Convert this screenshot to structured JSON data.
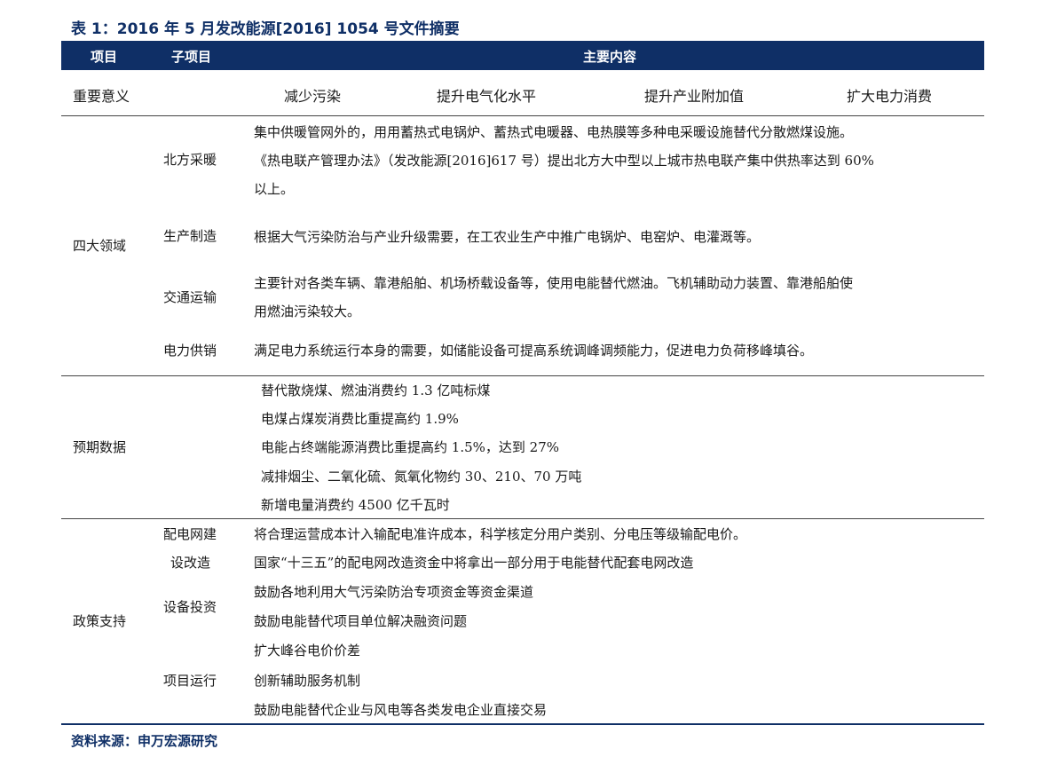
{
  "caption": "表 1：2016 年 5 月发改能源[2016] 1054 号文件摘要",
  "header": {
    "col1": "项目",
    "col2": "子项目",
    "col3": "主要内容"
  },
  "significance": {
    "label": "重要意义",
    "items": [
      "减少污染",
      "提升电气化水平",
      "提升产业附加值",
      "扩大电力消费"
    ]
  },
  "four_areas": {
    "label": "四大领域",
    "heating": {
      "label": "北方采暖",
      "lines": [
        "集中供暖管网外的，用用蓄热式电锅炉、蓄热式电暖器、电热膜等多种电采暖设施替代分散燃煤设施。",
        "《热电联产管理办法》（发改能源[2016]617 号）提出北方大中型以上城市热电联产集中供热率达到 60%",
        "以上。"
      ]
    },
    "manufacturing": {
      "label": "生产制造",
      "lines": [
        "根据大气污染防治与产业升级需要，在工农业生产中推广电锅炉、电窑炉、电灌溉等。"
      ]
    },
    "transport": {
      "label": "交通运输",
      "lines": [
        "主要针对各类车辆、靠港船舶、机场桥载设备等，使用电能替代燃油。飞机辅助动力装置、靠港船舶使",
        "用燃油污染较大。"
      ]
    },
    "power": {
      "label": "电力供销",
      "lines": [
        "满足电力系统运行本身的需要，如储能设备可提高系统调峰调频能力，促进电力负荷移峰填谷。"
      ]
    }
  },
  "expected": {
    "label": "预期数据",
    "lines": [
      "替代散烧煤、燃油消费约 1.3 亿吨标煤",
      "电煤占煤炭消费比重提高约 1.9%",
      "电能占终端能源消费比重提高约 1.5%，达到 27%",
      "减排烟尘、二氧化硫、氮氧化物约 30、210、70 万吨",
      "新增电量消费约 4500 亿千瓦时"
    ]
  },
  "policy": {
    "label": "政策支持",
    "grid": {
      "label_line1": "配电网建",
      "label_line2": "设改造",
      "lines": [
        "将合理运营成本计入输配电准许成本，科学核定分用户类别、分电压等级输配电价。",
        "国家“十三五”的配电网改造资金中将拿出一部分用于电能替代配套电网改造"
      ]
    },
    "investment": {
      "label": "设备投资",
      "lines": [
        "鼓励各地利用大气污染防治专项资金等资金渠道",
        "鼓励电能替代项目单位解决融资问题"
      ]
    },
    "operation": {
      "label": "项目运行",
      "lines": [
        "扩大峰谷电价价差",
        "创新辅助服务机制",
        "鼓励电能替代企业与风电等各类发电企业直接交易"
      ]
    }
  },
  "source": "资料来源：申万宏源研究",
  "colors": {
    "header_bg": "#0f2f66",
    "accent": "#0f2f66"
  }
}
